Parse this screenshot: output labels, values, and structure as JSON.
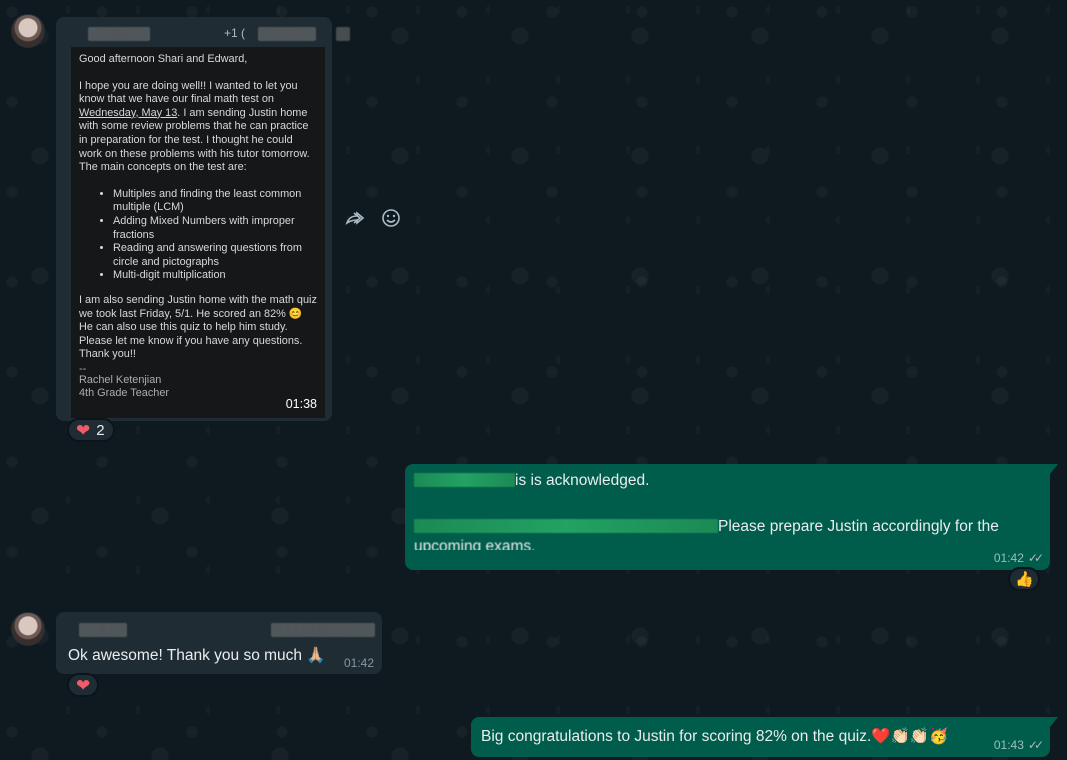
{
  "messages": {
    "m1": {
      "sender_phone_prefix": "+1 (",
      "time": "01:38",
      "doc": {
        "greeting": "Good afternoon Shari and Edward,",
        "para1_a": "I hope you are doing well!! I wanted to let you know that we have our final math test on ",
        "para1_date": "Wednesday, May 13",
        "para1_b": ". I am sending Justin home with some review problems that he can practice in preparation for the test. I thought he could work on these problems with his tutor tomorrow. The main concepts on the test are:",
        "bullets": [
          "Multiples and finding the least common multiple (LCM)",
          "Adding Mixed Numbers with improper fractions",
          "Reading and answering questions from circle and pictographs",
          "Multi-digit multiplication"
        ],
        "para2": "I am also sending Justin home with the math quiz we took last Friday, 5/1. He scored an 82% 😊 He can also use this quiz to help him study. Please let me know if you have any questions. Thank you!!",
        "sig_dash": "--",
        "sig_name": "Rachel Ketenjian",
        "sig_title": "4th Grade Teacher"
      },
      "reaction": {
        "emoji": "❤",
        "count": "2"
      }
    },
    "m2": {
      "line1_suffix": "is is acknowledged.",
      "line2_suffix": "Please prepare Justin accordingly for the",
      "line3": "upcoming exams.",
      "time": "01:42",
      "reaction": {
        "emoji": "👍"
      }
    },
    "m3": {
      "text": "Ok awesome! Thank you so much 🙏🏼",
      "time": "01:42",
      "reaction": {
        "emoji": "❤"
      }
    },
    "m4": {
      "text": "Big congratulations to Justin for scoring 82% on the quiz.❤️👏🏻👏🏻🥳",
      "time": "01:43"
    }
  },
  "colors": {
    "incoming_bubble": "#202c33",
    "outgoing_bubble": "#005c4b",
    "background": "#0b141a"
  },
  "icons": [
    "forward-icon",
    "emoji-react-icon",
    "read-ticks-icon"
  ]
}
